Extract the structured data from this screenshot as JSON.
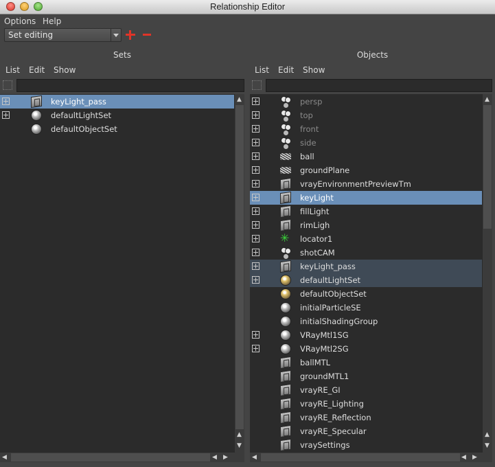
{
  "window": {
    "title": "Relationship Editor"
  },
  "menu": [
    "Options",
    "Help"
  ],
  "mode": {
    "value": "Set editing"
  },
  "left": {
    "title": "Sets",
    "menu": [
      "List",
      "Edit",
      "Show"
    ],
    "filter_value": "",
    "items": [
      {
        "label": "keyLight_pass",
        "icon": "set-icon",
        "expand": true,
        "state": "selected",
        "dim": false
      },
      {
        "label": "defaultLightSet",
        "icon": "sphere-icon",
        "expand": true,
        "state": "",
        "dim": false
      },
      {
        "label": "defaultObjectSet",
        "icon": "sphere-icon",
        "expand": false,
        "state": "",
        "dim": false
      }
    ]
  },
  "right": {
    "title": "Objects",
    "menu": [
      "List",
      "Edit",
      "Show"
    ],
    "filter_value": "",
    "items": [
      {
        "label": "persp",
        "icon": "camera-icon",
        "expand": true,
        "state": "",
        "dim": true
      },
      {
        "label": "top",
        "icon": "camera-icon",
        "expand": true,
        "state": "",
        "dim": true
      },
      {
        "label": "front",
        "icon": "camera-icon",
        "expand": true,
        "state": "",
        "dim": true
      },
      {
        "label": "side",
        "icon": "camera-icon",
        "expand": true,
        "state": "",
        "dim": true
      },
      {
        "label": "ball",
        "icon": "mesh-icon",
        "expand": true,
        "state": "",
        "dim": false
      },
      {
        "label": "groundPlane",
        "icon": "mesh-icon",
        "expand": true,
        "state": "",
        "dim": false
      },
      {
        "label": "vrayEnvironmentPreviewTm",
        "icon": "set-icon",
        "expand": true,
        "state": "",
        "dim": false
      },
      {
        "label": "keyLight",
        "icon": "set-icon",
        "expand": true,
        "state": "selected",
        "dim": false
      },
      {
        "label": "fillLight",
        "icon": "set-icon",
        "expand": true,
        "state": "",
        "dim": false
      },
      {
        "label": "rimLigh",
        "icon": "set-icon",
        "expand": true,
        "state": "",
        "dim": false
      },
      {
        "label": "locator1",
        "icon": "locator-icon",
        "expand": true,
        "state": "",
        "dim": false
      },
      {
        "label": "shotCAM",
        "icon": "camera-icon",
        "expand": true,
        "state": "",
        "dim": false
      },
      {
        "label": "keyLight_pass",
        "icon": "set-icon",
        "expand": true,
        "state": "highlight",
        "dim": false
      },
      {
        "label": "defaultLightSet",
        "icon": "sphere-gold-icon",
        "expand": true,
        "state": "highlight",
        "dim": false
      },
      {
        "label": "defaultObjectSet",
        "icon": "sphere-gold-icon",
        "expand": false,
        "state": "",
        "dim": false
      },
      {
        "label": "initialParticleSE",
        "icon": "sphere-icon",
        "expand": false,
        "state": "",
        "dim": false
      },
      {
        "label": "initialShadingGroup",
        "icon": "sphere-icon",
        "expand": false,
        "state": "",
        "dim": false
      },
      {
        "label": "VRayMtl1SG",
        "icon": "sphere-icon",
        "expand": true,
        "state": "",
        "dim": false
      },
      {
        "label": "VRayMtl2SG",
        "icon": "sphere-icon",
        "expand": true,
        "state": "",
        "dim": false
      },
      {
        "label": "ballMTL",
        "icon": "set-icon",
        "expand": false,
        "state": "",
        "dim": false
      },
      {
        "label": "groundMTL1",
        "icon": "set-icon",
        "expand": false,
        "state": "",
        "dim": false
      },
      {
        "label": "vrayRE_GI",
        "icon": "set-icon",
        "expand": false,
        "state": "",
        "dim": false
      },
      {
        "label": "vrayRE_Lighting",
        "icon": "set-icon",
        "expand": false,
        "state": "",
        "dim": false
      },
      {
        "label": "vrayRE_Reflection",
        "icon": "set-icon",
        "expand": false,
        "state": "",
        "dim": false
      },
      {
        "label": "vrayRE_Specular",
        "icon": "set-icon",
        "expand": false,
        "state": "",
        "dim": false
      },
      {
        "label": "vraySettings",
        "icon": "set-icon",
        "expand": false,
        "state": "",
        "dim": false
      }
    ]
  }
}
